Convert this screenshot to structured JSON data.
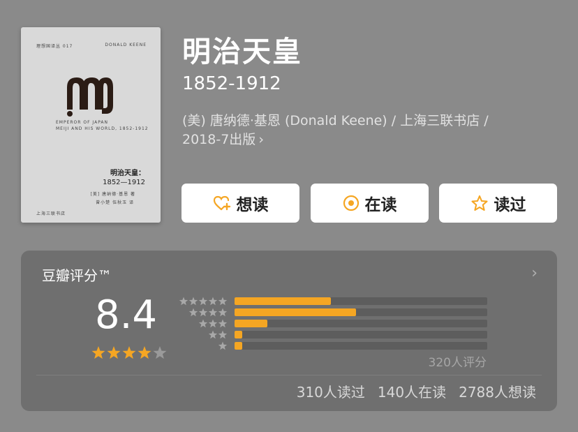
{
  "book": {
    "title": "明治天皇",
    "subtitle": "1852-1912",
    "meta_line1": "(美) 唐纳德·基恩 (Donald Keene) / 上海三联书店 /",
    "meta_line2": "2018-7出版",
    "meta_chevron": "›"
  },
  "cover": {
    "top_left": "理想国译丛 017",
    "top_right": "DONALD KEENE",
    "emblem_letter": "M",
    "sub_line1": "EMPEROR OF JAPAN",
    "sub_line2": "MEIJI AND HIS WORLD, 1852-1912",
    "title": "明治天皇：",
    "years": "1852—1912",
    "author_line1": "[美] 唐纳德·基恩  著",
    "author_line2": "曾小楚 伍秋玉  译",
    "publisher": "上海三联书店"
  },
  "actions": {
    "want_label": "想读",
    "reading_label": "在读",
    "read_label": "读过"
  },
  "rating": {
    "panel_title": "豆瓣评分™",
    "panel_chevron": "›",
    "score": "8.4",
    "stars_value": 4,
    "stars_max": 5,
    "distribution": [
      {
        "stars": 5,
        "fraction": 0.38
      },
      {
        "stars": 4,
        "fraction": 0.48
      },
      {
        "stars": 3,
        "fraction": 0.13
      },
      {
        "stars": 2,
        "fraction": 0.03
      },
      {
        "stars": 1,
        "fraction": 0.03
      }
    ],
    "count_text": "320人评分",
    "stats": {
      "read": "310人读过",
      "reading": "140人在读",
      "want": "2788人想读"
    }
  },
  "colors": {
    "accent": "#f5a623",
    "background": "#8a8a8a",
    "panel": "#6f6f6f"
  }
}
